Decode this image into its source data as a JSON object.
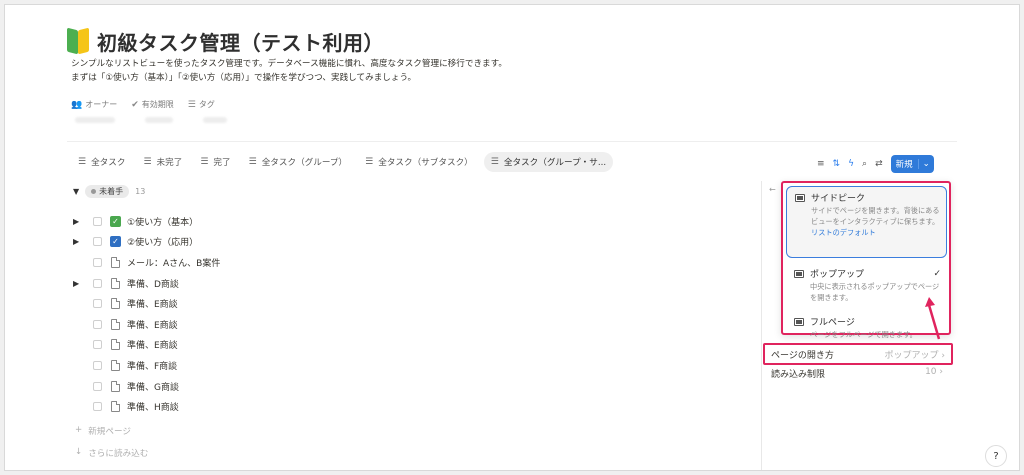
{
  "page": {
    "title": "初級タスク管理（テスト利用）",
    "desc_line1": "シンプルなリストビューを使ったタスク管理です。データベース機能に慣れ、高度なタスク管理に移行できます。",
    "desc_line2": "まずは「①使い方（基本）」「②使い方（応用）」で操作を学びつつ、実践してみましょう。"
  },
  "props": [
    {
      "icon": "people-icon",
      "label": "オーナー"
    },
    {
      "icon": "check-circle-icon",
      "label": "有効期限"
    },
    {
      "icon": "list-icon",
      "label": "タグ"
    }
  ],
  "tabs": [
    "全タスク",
    "未完了",
    "完了",
    "全タスク（グループ）",
    "全タスク（サブタスク）",
    "全タスク（グループ・サ..."
  ],
  "toolbar": {
    "new_label": "新規"
  },
  "group": {
    "label": "未着手",
    "count": "13"
  },
  "rows": [
    {
      "label": "①使い方（基本）",
      "toggle": true,
      "type": "green"
    },
    {
      "label": "②使い方（応用）",
      "toggle": true,
      "type": "blue"
    },
    {
      "label": "メール：Aさん、B案件",
      "toggle": false,
      "type": "doc"
    },
    {
      "label": "準備、D商談",
      "toggle": true,
      "type": "doc"
    },
    {
      "label": "準備、E商談",
      "toggle": false,
      "type": "doc"
    },
    {
      "label": "準備、E商談",
      "toggle": false,
      "type": "doc"
    },
    {
      "label": "準備、E商談",
      "toggle": false,
      "type": "doc"
    },
    {
      "label": "準備、F商談",
      "toggle": false,
      "type": "doc"
    },
    {
      "label": "準備、G商談",
      "toggle": false,
      "type": "doc"
    },
    {
      "label": "準備、H商談",
      "toggle": false,
      "type": "doc"
    }
  ],
  "footer": {
    "new_page": "新規ページ",
    "load_more": "さらに読み込む"
  },
  "dropdown": {
    "side": {
      "name": "サイドピーク",
      "sub": "サイドでページを開きます。背後にあるビューをインタラクティブに保ちます。",
      "default": "リストのデフォルト"
    },
    "popup": {
      "name": "ポップアップ",
      "sub": "中央に表示されるポップアップでページを開きます。"
    },
    "full": {
      "name": "フルページ",
      "sub": "ページをフルページで開きます。"
    }
  },
  "settings": {
    "open_label": "ページの開き方",
    "open_value": "ポップアップ",
    "load_label": "読み込み制限",
    "load_value": "10"
  },
  "colors": {
    "accent": "#2f7ad9",
    "highlight": "#e0245e"
  }
}
